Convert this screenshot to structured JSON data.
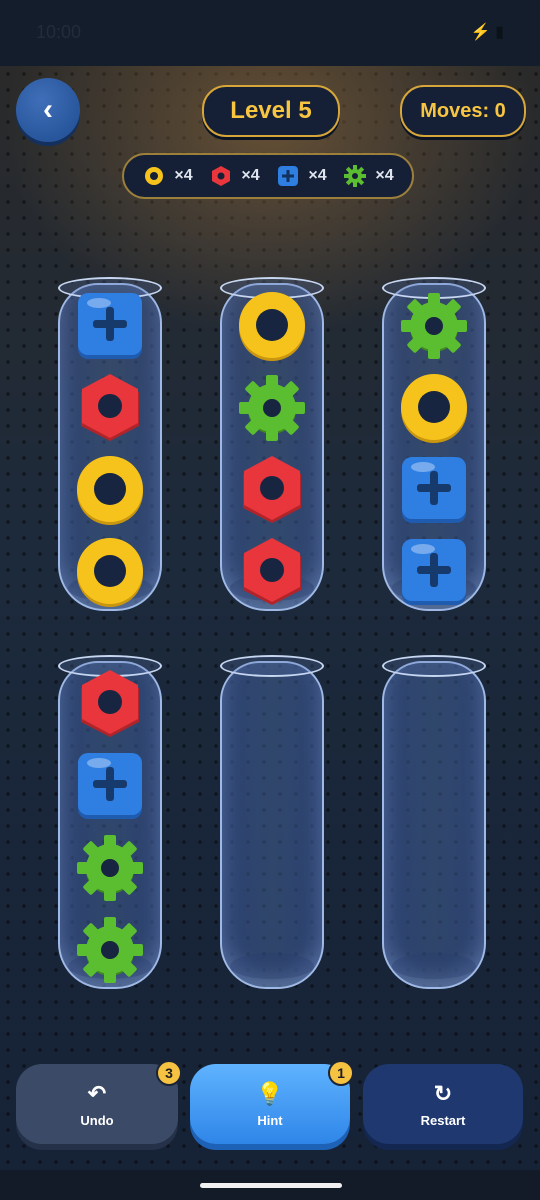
{
  "status_bar": {
    "time": "10:00"
  },
  "header": {
    "level": "Level 5",
    "moves": "Moves: 0"
  },
  "legend": [
    {
      "shape": "washer-icon",
      "color": "#f6c21c",
      "count": "×4"
    },
    {
      "shape": "hex-nut-icon",
      "color": "#e8363c",
      "count": "×4"
    },
    {
      "shape": "plus-block-icon",
      "color": "#2f7fe3",
      "count": "×4"
    },
    {
      "shape": "gear-icon",
      "color": "#5bbd30",
      "count": "×4"
    }
  ],
  "tubes": [
    [
      "plus-block",
      "hex-nut",
      "washer",
      "washer"
    ],
    [
      "washer",
      "gear",
      "hex-nut",
      "hex-nut"
    ],
    [
      "gear",
      "washer",
      "plus-block",
      "plus-block"
    ],
    [
      "hex-nut",
      "plus-block",
      "gear",
      "gear"
    ],
    [],
    []
  ],
  "buttons": {
    "undo": {
      "label": "Undo",
      "badge": "3"
    },
    "hint": {
      "label": "Hint",
      "badge": "1"
    },
    "restart": {
      "label": "Restart"
    }
  }
}
